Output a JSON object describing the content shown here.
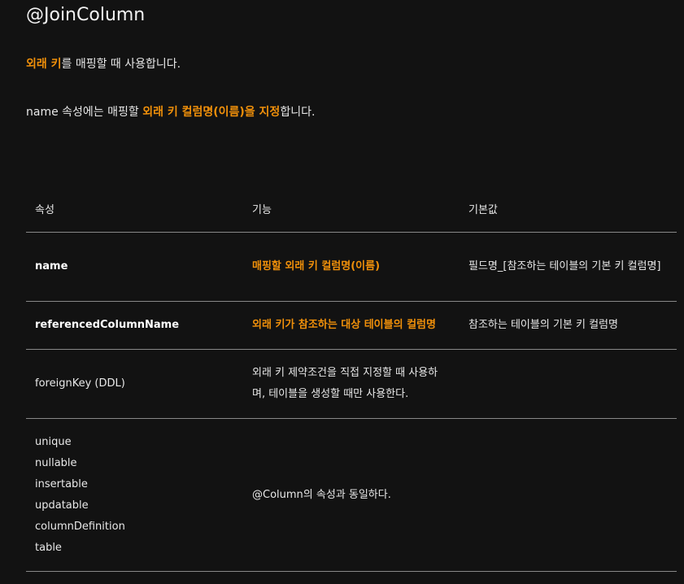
{
  "title": "@JoinColumn",
  "p1": {
    "hl": "외래 키",
    "rest": "를 매핑할 때 사용합니다."
  },
  "p2": {
    "pre": "name 속성에는 매핑할 ",
    "hl": "외래 키 컬럼명(이름)을 지정",
    "post": "합니다."
  },
  "table": {
    "headers": [
      "속성",
      "기능",
      "기본값"
    ],
    "rows": [
      {
        "attr": "name",
        "func": "매핑할 외래 키 컬럼명(이름)",
        "def": "필드명_[참조하는 테이블의 기본 키 컬럼명]"
      },
      {
        "attr": "referencedColumnName",
        "func": "외래 키가 참조하는 대상 테이블의 컬럼명",
        "def": "참조하는 테이블의 기본 키 컬럼명"
      },
      {
        "attr": "foreignKey (DDL)",
        "func": "외래 키 제약조건을 직접 지정할 때 사용하며, 테이블을 생성할 때만 사용한다.",
        "def": ""
      },
      {
        "attrs": [
          "unique",
          "nullable",
          "insertable",
          "updatable",
          "columnDefinition",
          "table"
        ],
        "func": "@Column의 속성과 동일하다.",
        "def": ""
      }
    ]
  },
  "colors": {
    "accent": "#f0900a",
    "background": "#121212"
  }
}
